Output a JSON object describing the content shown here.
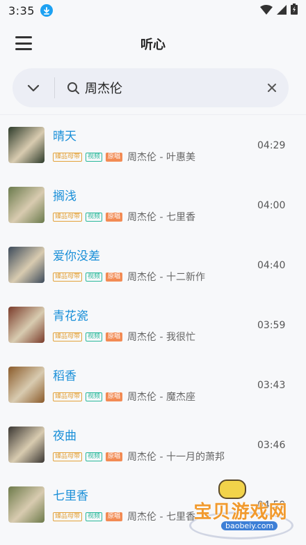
{
  "status_bar": {
    "time": "3:35",
    "download_icon": "download-circle-icon",
    "wifi_icon": "wifi-icon",
    "signal_icon": "signal-icon",
    "battery_icon": "battery-icon"
  },
  "header": {
    "title": "听心",
    "menu_icon": "hamburger-menu-icon"
  },
  "search": {
    "value": "周杰伦",
    "toggle_icon": "chevron-down-icon",
    "search_icon": "search-icon",
    "clear_icon": "close-icon"
  },
  "tags": {
    "master": "臻品母带",
    "video": "视频",
    "original": "原唱"
  },
  "songs": [
    {
      "title": "晴天",
      "artist": "周杰伦 - 叶惠美",
      "duration": "04:29",
      "cover_color": "#2d3b2a"
    },
    {
      "title": "搁浅",
      "artist": "周杰伦 - 七里香",
      "duration": "04:00",
      "cover_color": "#6a7a4c"
    },
    {
      "title": "爱你没差",
      "artist": "周杰伦 - 十二新作",
      "duration": "04:40",
      "cover_color": "#3c4a5a"
    },
    {
      "title": "青花瓷",
      "artist": "周杰伦 - 我很忙",
      "duration": "03:59",
      "cover_color": "#7a3b2a"
    },
    {
      "title": "稻香",
      "artist": "周杰伦 - 魔杰座",
      "duration": "03:43",
      "cover_color": "#8a5a2a"
    },
    {
      "title": "夜曲",
      "artist": "周杰伦 - 十一月的萧邦",
      "duration": "03:46",
      "cover_color": "#3a3632"
    },
    {
      "title": "七里香",
      "artist": "周杰伦 - 七里香",
      "duration": "04:59",
      "cover_color": "#6d7a4a"
    }
  ],
  "watermark": {
    "text": "宝贝游戏网",
    "url": "baobeiy.com"
  },
  "colors": {
    "accent": "#1a8fd8",
    "tag_master": "#e3a23a",
    "tag_video": "#29b89a",
    "tag_original": "#f28b54"
  }
}
